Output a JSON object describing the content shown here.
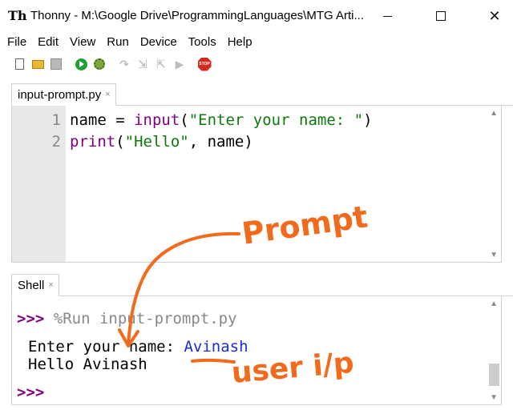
{
  "window": {
    "app_icon_text": "Th",
    "title": "Thonny  -  M:\\Google Drive\\ProgrammingLanguages\\MTG Arti..."
  },
  "menu": [
    "File",
    "Edit",
    "View",
    "Run",
    "Device",
    "Tools",
    "Help"
  ],
  "toolbar": {
    "icons": [
      "new-file-icon",
      "open-file-icon",
      "save-icon",
      "run-icon",
      "debug-icon",
      "step-over-icon",
      "step-into-icon",
      "step-out-icon",
      "resume-icon",
      "stop-icon"
    ],
    "stop_text": "STOP"
  },
  "editor": {
    "tab_label": "input-prompt.py",
    "tab_close": "×",
    "line_numbers": [
      "1",
      "2"
    ],
    "lines": [
      [
        {
          "t": "name = ",
          "c": ""
        },
        {
          "t": "input",
          "c": "kw"
        },
        {
          "t": "(",
          "c": ""
        },
        {
          "t": "\"Enter your name: \"",
          "c": "str"
        },
        {
          "t": ")",
          "c": ""
        }
      ],
      [
        {
          "t": "print",
          "c": "kw"
        },
        {
          "t": "(",
          "c": ""
        },
        {
          "t": "\"Hello\"",
          "c": "str"
        },
        {
          "t": ", name)",
          "c": ""
        }
      ]
    ]
  },
  "shell": {
    "tab_label": "Shell",
    "tab_close": "×",
    "prompt": ">>>",
    "run_command": "%Run input-prompt.py",
    "input_prompt": "Enter your name: ",
    "user_input": "Avinash",
    "output_line": "Hello Avinash"
  },
  "annotations": {
    "prompt_label": "Prompt",
    "user_input_label": "user i/p"
  },
  "colors": {
    "keyword": "#800080",
    "string": "#0b7a0b",
    "user_input": "#1a2fdc",
    "annotation": "#f26b1d"
  }
}
